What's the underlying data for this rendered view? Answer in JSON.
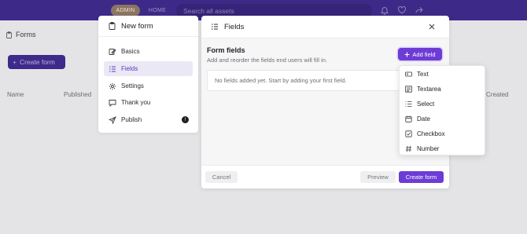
{
  "topbar": {
    "admin_label": "ADMIN",
    "home_label": "HOME",
    "search_placeholder": "Search all assets"
  },
  "page": {
    "title": "Forms",
    "create_button": "Create form",
    "columns": [
      "Name",
      "Published",
      "Created"
    ]
  },
  "steps_panel": {
    "title": "New form",
    "steps": [
      {
        "label": "Basics",
        "icon": "edit-icon"
      },
      {
        "label": "Fields",
        "icon": "list-icon",
        "active": true
      },
      {
        "label": "Settings",
        "icon": "gear-icon"
      },
      {
        "label": "Thank you",
        "icon": "message-icon"
      },
      {
        "label": "Publish",
        "icon": "send-icon",
        "badge": "!"
      }
    ]
  },
  "dialog": {
    "title": "Fields",
    "section_title": "Form fields",
    "section_subtitle": "Add and reorder the fields end users will fill in.",
    "add_field_label": "Add field",
    "empty_state": "No fields added yet. Start by adding your first field.",
    "cancel_label": "Cancel",
    "preview_label": "Preview",
    "create_label": "Create form"
  },
  "field_menu": {
    "items": [
      {
        "label": "Text",
        "icon": "text-field-icon"
      },
      {
        "label": "Textarea",
        "icon": "textarea-icon"
      },
      {
        "label": "Select",
        "icon": "select-list-icon"
      },
      {
        "label": "Date",
        "icon": "calendar-icon"
      },
      {
        "label": "Checkbox",
        "icon": "checkbox-icon"
      },
      {
        "label": "Number",
        "icon": "hash-icon"
      }
    ]
  },
  "colors": {
    "topbar": "#3d2a88",
    "accent": "#6d3bd6",
    "active_step_bg": "#ebe8f6",
    "backdrop": "#e4e4e6"
  }
}
